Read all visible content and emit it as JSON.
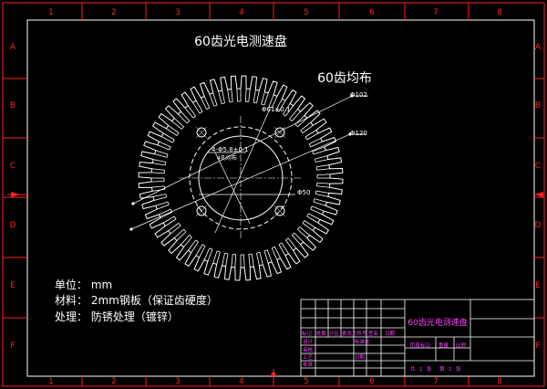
{
  "border": {
    "top_numbers": [
      "1",
      "2",
      "3",
      "4",
      "5",
      "6",
      "7",
      "8"
    ],
    "bottom_numbers": [
      "1",
      "2",
      "3",
      "4",
      "5",
      "6",
      "7",
      "8"
    ],
    "left_letters": [
      "A",
      "B",
      "C",
      "D",
      "E",
      "F"
    ],
    "right_letters": [
      "A",
      "B",
      "C",
      "D",
      "E",
      "F"
    ]
  },
  "drawing": {
    "title": "60齿光电测速盘",
    "subtitle": "60齿均布",
    "teeth_count": 60,
    "dims": {
      "outer_dia": "Φ102",
      "tooth_root_dia": "Φ120",
      "bolt_circle_dia": "Φ61±0.1",
      "holes": "4-Φ5.8±0.1",
      "holes_note": "4孔均布",
      "hub_dia": "Φ50"
    }
  },
  "notes": {
    "unit": "单位：  mm",
    "material": "材料：  2mm钢板（保证齿硬度）",
    "treatment": "处理：  防锈处理（镀锌）"
  },
  "title_block": {
    "drawing_name": "60齿光电测速盘",
    "row_headers": [
      "标记",
      "处数",
      "分区",
      "更改文件号",
      "签名",
      "日期"
    ],
    "left_rows": [
      "设计",
      "审核",
      "工艺",
      "批准"
    ],
    "mid_rows": [
      "标准化",
      "日期"
    ],
    "right_headers": [
      "阶段标记",
      "重量",
      "比例"
    ],
    "sheet_info": [
      "共",
      "1",
      "张",
      "第",
      "1",
      "张"
    ]
  },
  "colors": {
    "background": "#000000",
    "lines": "#ffffff",
    "frame_red": "#ff2020",
    "pink": "#ff40ff"
  }
}
